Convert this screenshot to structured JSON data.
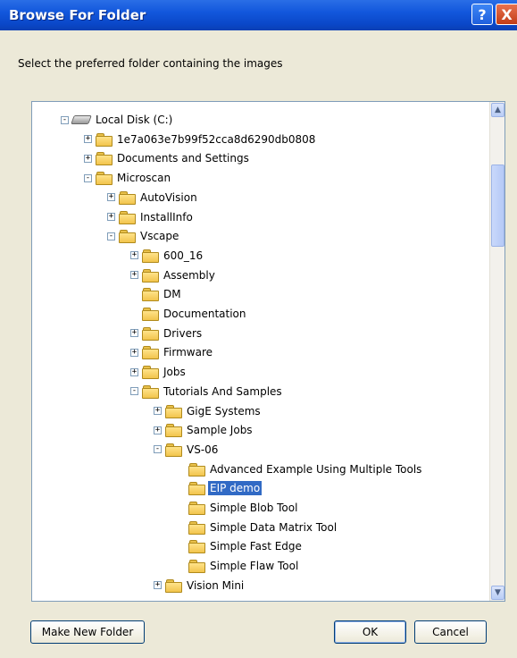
{
  "window": {
    "title": "Browse For Folder",
    "help_glyph": "?",
    "close_glyph": "X"
  },
  "instruction": "Select the preferred folder containing the images",
  "tree": {
    "items": [
      {
        "label": "Local Disk (C:)",
        "level": 0,
        "expander": "-",
        "icon": "drive-icon"
      },
      {
        "label": "1e7a063e7b99f52cca8d6290db0808",
        "level": 1,
        "expander": "+",
        "icon": "folder-icon"
      },
      {
        "label": "Documents and Settings",
        "level": 1,
        "expander": "+",
        "icon": "folder-icon"
      },
      {
        "label": "Microscan",
        "level": 1,
        "expander": "-",
        "icon": "folder-icon"
      },
      {
        "label": "AutoVision",
        "level": 2,
        "expander": "+",
        "icon": "folder-icon"
      },
      {
        "label": "InstallInfo",
        "level": 2,
        "expander": "+",
        "icon": "folder-icon"
      },
      {
        "label": "Vscape",
        "level": 2,
        "expander": "-",
        "icon": "folder-icon"
      },
      {
        "label": "600_16",
        "level": 3,
        "expander": "+",
        "icon": "folder-icon"
      },
      {
        "label": "Assembly",
        "level": 3,
        "expander": "+",
        "icon": "folder-icon"
      },
      {
        "label": "DM",
        "level": 3,
        "expander": "",
        "icon": "folder-icon"
      },
      {
        "label": "Documentation",
        "level": 3,
        "expander": "",
        "icon": "folder-icon"
      },
      {
        "label": "Drivers",
        "level": 3,
        "expander": "+",
        "icon": "folder-icon"
      },
      {
        "label": "Firmware",
        "level": 3,
        "expander": "+",
        "icon": "folder-icon"
      },
      {
        "label": "Jobs",
        "level": 3,
        "expander": "+",
        "icon": "folder-icon"
      },
      {
        "label": "Tutorials And Samples",
        "level": 3,
        "expander": "-",
        "icon": "folder-icon"
      },
      {
        "label": "GigE Systems",
        "level": 4,
        "expander": "+",
        "icon": "folder-icon"
      },
      {
        "label": "Sample Jobs",
        "level": 4,
        "expander": "+",
        "icon": "folder-icon"
      },
      {
        "label": "VS-06",
        "level": 4,
        "expander": "-",
        "icon": "folder-icon"
      },
      {
        "label": "Advanced Example Using Multiple Tools",
        "level": 5,
        "expander": "",
        "icon": "folder-icon"
      },
      {
        "label": "EIP demo",
        "level": 5,
        "expander": "",
        "icon": "folder-icon",
        "selected": true
      },
      {
        "label": "Simple Blob Tool",
        "level": 5,
        "expander": "",
        "icon": "folder-icon"
      },
      {
        "label": "Simple Data Matrix Tool",
        "level": 5,
        "expander": "",
        "icon": "folder-icon"
      },
      {
        "label": "Simple Fast Edge",
        "level": 5,
        "expander": "",
        "icon": "folder-icon"
      },
      {
        "label": "Simple Flaw Tool",
        "level": 5,
        "expander": "",
        "icon": "folder-icon"
      },
      {
        "label": "Vision Mini",
        "level": 4,
        "expander": "+",
        "icon": "folder-icon"
      }
    ]
  },
  "buttons": {
    "make_new_folder": "Make New Folder",
    "ok": "OK",
    "cancel": "Cancel"
  },
  "colors": {
    "title_bar": "#0a47c8",
    "selection": "#316ac5",
    "dialog_bg": "#ece9d8"
  }
}
